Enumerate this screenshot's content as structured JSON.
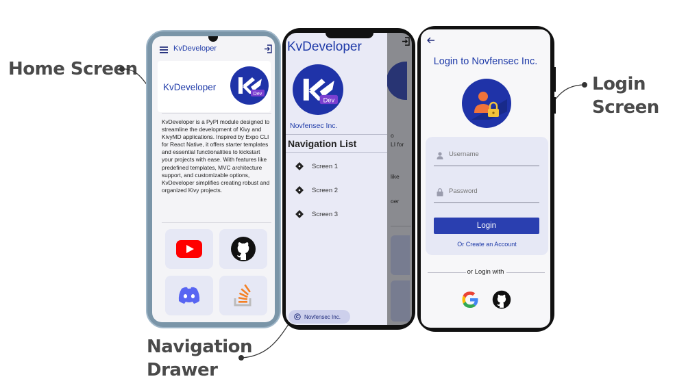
{
  "callouts": {
    "home": "Home Screen",
    "login": "Login Screen",
    "drawer_line1": "Navigation",
    "drawer_line2": "Drawer"
  },
  "home": {
    "app_title": "KvDeveloper",
    "card_title": "KvDeveloper",
    "logo_badge": "Dev",
    "description": "KvDeveloper is a PyPI module designed to streamline the development of Kivy and KivyMD applications. Inspired by Expo CLI for React Native, it offers starter templates and essential functionalities to kickstart your projects with ease. With features like predefined templates, MVC architecture support, and customizable options, KvDeveloper simplifies creating robust and organized Kivy projects.",
    "tiles": [
      "youtube-icon",
      "github-icon",
      "discord-icon",
      "stackoverflow-icon"
    ]
  },
  "drawer": {
    "title": "KvDeveloper",
    "logo_badge": "Dev",
    "org": "Novfensec Inc.",
    "list_title": "Navigation List",
    "items": [
      "Screen 1",
      "Screen 2",
      "Screen 3"
    ],
    "footer": "Novfensec Inc.",
    "bg_peek": [
      "o",
      "LI for",
      "like",
      "oer"
    ]
  },
  "login": {
    "title": "Login to Novfensec Inc.",
    "username_placeholder": "Username",
    "password_placeholder": "Password",
    "login_button": "Login",
    "create_account": "Or Create an Account",
    "or_login_with": "or Login with",
    "providers": [
      "google-icon",
      "github-icon"
    ]
  },
  "colors": {
    "accent": "#2a3fb0",
    "title_blue": "#1e3aa8",
    "card_bg": "#e6e8f5",
    "logo_bg": "#1f33a8",
    "youtube": "#ff0000",
    "discord": "#5865f2",
    "stackoverflow": "#f48024"
  }
}
